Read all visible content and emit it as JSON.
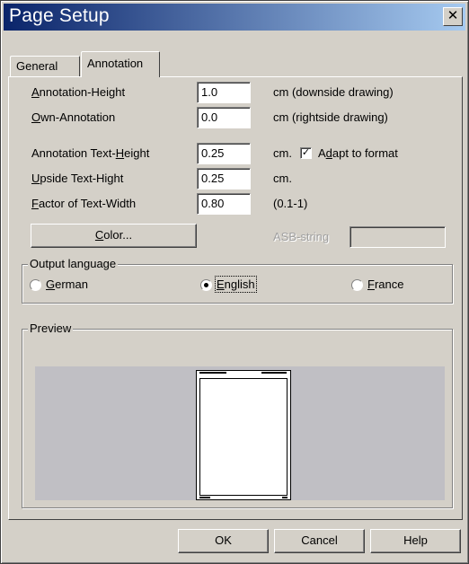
{
  "window": {
    "title": "Page Setup",
    "close_glyph": "✕"
  },
  "tabs": [
    {
      "label": "General",
      "active": false
    },
    {
      "label": "Annotation",
      "active": true
    }
  ],
  "fields": {
    "annotation_height": {
      "label_prefix": "A",
      "label_rest": "nnotation-Height",
      "value": "1.0",
      "unit": "cm (downside drawing)"
    },
    "own_annotation": {
      "label_prefix": "O",
      "label_rest": "wn-Annotation",
      "value": "0.0",
      "unit": "cm (rightside drawing)"
    },
    "annotation_text_height": {
      "label_before": "Annotation Text-",
      "label_key": "H",
      "label_after": "eight",
      "value": "0.25",
      "unit": "cm."
    },
    "upside_text_height": {
      "label_prefix": "U",
      "label_rest": "pside Text-Hight",
      "value": "0.25",
      "unit": "cm."
    },
    "factor_text_width": {
      "label_prefix": "F",
      "label_rest": "actor of Text-Width",
      "value": "0.80",
      "unit": "(0.1-1)"
    }
  },
  "adapt": {
    "label_before": "A",
    "label_key": "d",
    "label_after": "apt to format",
    "checked": true,
    "check_glyph": "✓"
  },
  "color_button": {
    "label_key": "C",
    "label_rest": "olor..."
  },
  "asb": {
    "label": "ASB-string",
    "value": ""
  },
  "output_language": {
    "title": "Output language",
    "options": [
      {
        "key": "G",
        "rest": "erman",
        "selected": false
      },
      {
        "key": "E",
        "rest": "nglish",
        "selected": true
      },
      {
        "key": "F",
        "rest": "rance",
        "selected": false
      }
    ]
  },
  "preview": {
    "title": "Preview"
  },
  "buttons": {
    "ok": "OK",
    "cancel": "Cancel",
    "help": "Help"
  },
  "colors": {
    "title_start": "#0a246a",
    "title_end": "#a6caf0",
    "dialog_bg": "#d4d0c8",
    "preview_bg": "#c0bfc4"
  }
}
